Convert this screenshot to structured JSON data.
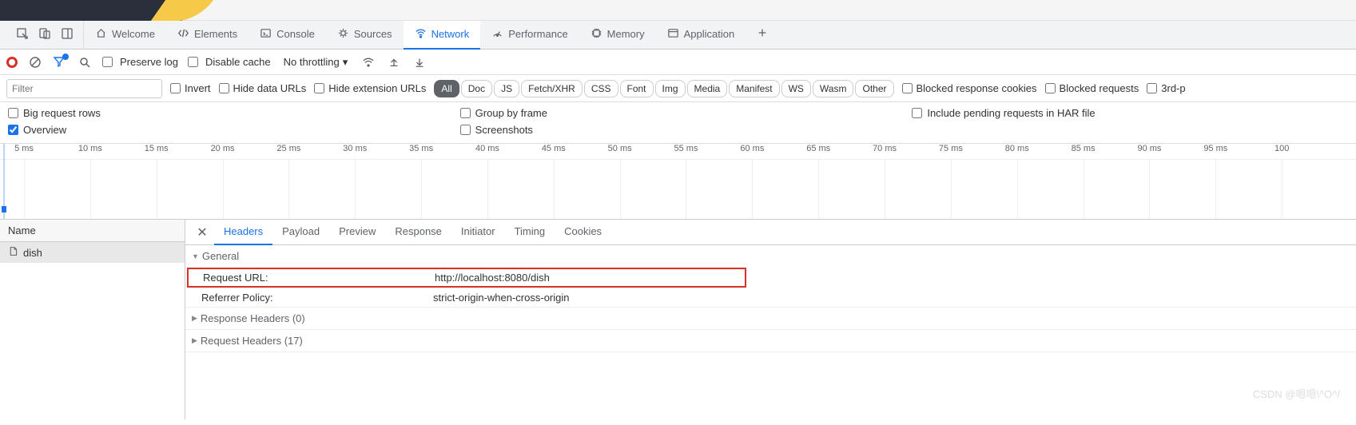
{
  "panelTabs": {
    "welcome": "Welcome",
    "elements": "Elements",
    "console": "Console",
    "sources": "Sources",
    "network": "Network",
    "performance": "Performance",
    "memory": "Memory",
    "application": "Application"
  },
  "toolbar": {
    "preserve_log": "Preserve log",
    "disable_cache": "Disable cache",
    "throttling": "No throttling"
  },
  "filterRow": {
    "filter_placeholder": "Filter",
    "invert": "Invert",
    "hide_data_urls": "Hide data URLs",
    "hide_ext_urls": "Hide extension URLs",
    "blocked_cookies": "Blocked response cookies",
    "blocked_requests": "Blocked requests",
    "third_party": "3rd-p",
    "types": {
      "all": "All",
      "doc": "Doc",
      "js": "JS",
      "fetchxhr": "Fetch/XHR",
      "css": "CSS",
      "font": "Font",
      "img": "Img",
      "media": "Media",
      "manifest": "Manifest",
      "ws": "WS",
      "wasm": "Wasm",
      "other": "Other"
    }
  },
  "options": {
    "big_rows": "Big request rows",
    "overview": "Overview",
    "group_by_frame": "Group by frame",
    "screenshots": "Screenshots",
    "pending_har": "Include pending requests in HAR file"
  },
  "timeline": {
    "ticks": [
      "5 ms",
      "10 ms",
      "15 ms",
      "20 ms",
      "25 ms",
      "30 ms",
      "35 ms",
      "40 ms",
      "45 ms",
      "50 ms",
      "55 ms",
      "60 ms",
      "65 ms",
      "70 ms",
      "75 ms",
      "80 ms",
      "85 ms",
      "90 ms",
      "95 ms",
      "100"
    ]
  },
  "namesCol": {
    "header": "Name",
    "items": [
      "dish"
    ]
  },
  "detailTabs": {
    "headers": "Headers",
    "payload": "Payload",
    "preview": "Preview",
    "response": "Response",
    "initiator": "Initiator",
    "timing": "Timing",
    "cookies": "Cookies"
  },
  "sections": {
    "general": "General",
    "response_headers": "Response Headers (0)",
    "request_headers": "Request Headers (17)"
  },
  "general": {
    "request_url_label": "Request URL:",
    "request_url_value": "http://localhost:8080/dish",
    "referrer_label": "Referrer Policy:",
    "referrer_value": "strict-origin-when-cross-origin"
  },
  "watermark": "CSDN @嗯嗯\\^O^/"
}
